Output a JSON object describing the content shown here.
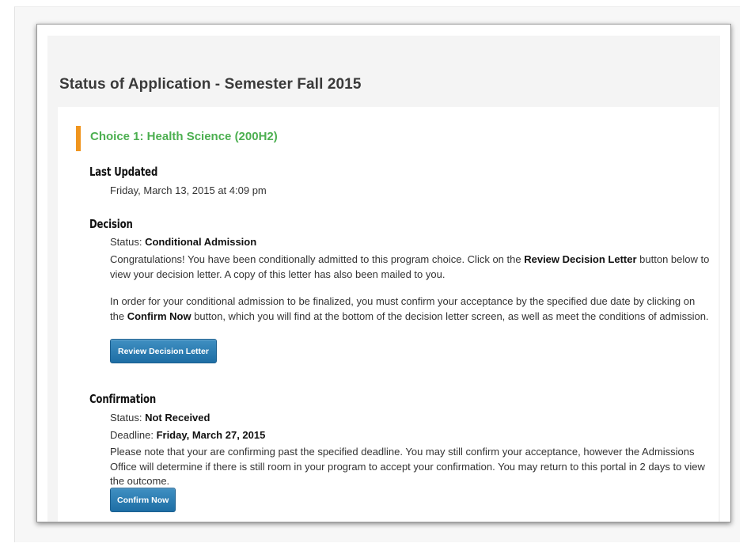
{
  "page": {
    "title": "Status of Application - Semester Fall 2015"
  },
  "choice": {
    "title": "Choice 1: Health Science (200H2)"
  },
  "last_updated": {
    "heading": "Last Updated",
    "value": "Friday, March 13, 2015 at 4:09 pm"
  },
  "decision": {
    "heading": "Decision",
    "status_label": "Status:",
    "status_value": "Conditional Admission",
    "p1_before": "Congratulations! You have been conditionally admitted to this program choice. Click on the ",
    "p1_bold": "Review Decision Letter",
    "p1_after": " button below to view your decision letter. A copy of this letter has also been mailed to you.",
    "p2_before": "In order for your conditional admission to be finalized, you must confirm your acceptance by the specified due date by clicking on the ",
    "p2_bold": "Confirm Now",
    "p2_after": " button, which you will find at the bottom of the decision letter screen, as well as meet the conditions of admission.",
    "button_label": "Review Decision Letter"
  },
  "confirmation": {
    "heading": "Confirmation",
    "status_label": "Status:",
    "status_value": "Not Received",
    "deadline_label": "Deadline:",
    "deadline_value": "Friday, March 27, 2015",
    "note": "Please note that your are confirming past the specified deadline. You may still confirm your acceptance, however the Admissions Office will determine if there is still room in your program to accept your confirmation. You may return to this portal in 2 days to view the outcome.",
    "button_label": "Confirm Now"
  },
  "colors": {
    "accent_orange": "#f0951e",
    "choice_green": "#4caf50",
    "button_blue": "#2a7db5"
  }
}
